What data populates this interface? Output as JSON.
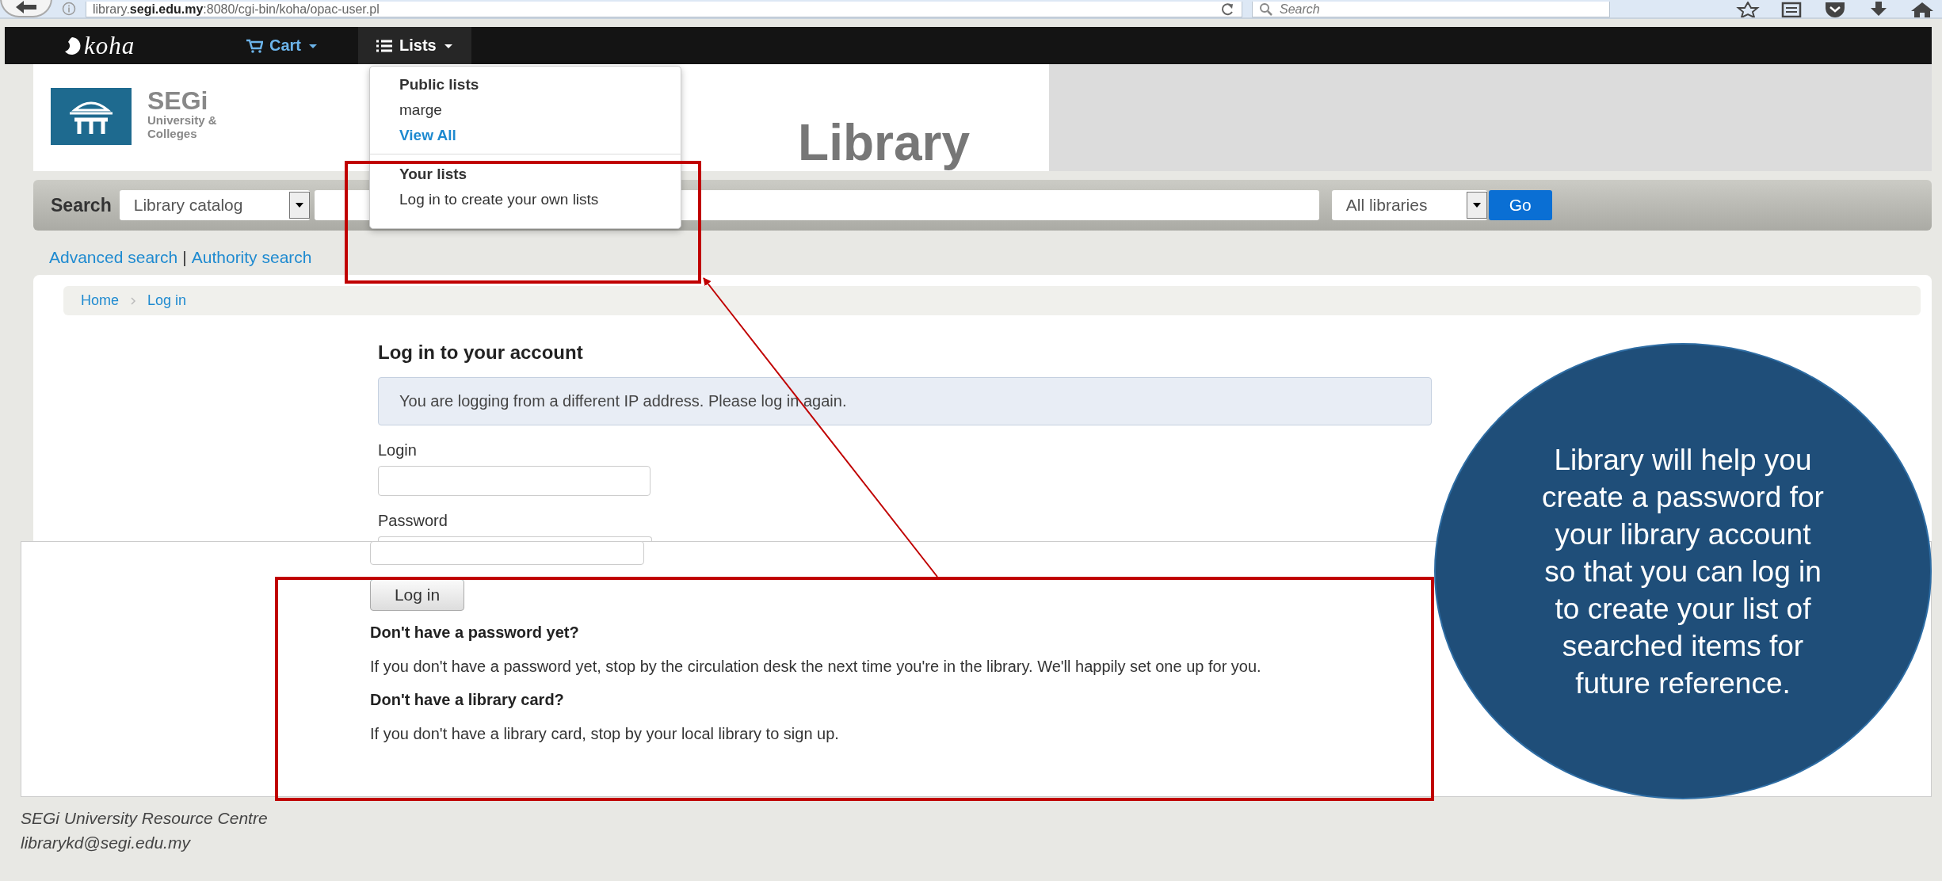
{
  "browser": {
    "address": "library.**segi.edu.my**:8080/cgi-bin/koha/opac-user.pl",
    "search_placeholder": "Search"
  },
  "navbar": {
    "logo": "koha",
    "menus": [
      {
        "label": "Cart",
        "kind": "cart",
        "expanded": false
      },
      {
        "label": "Lists",
        "kind": "lists",
        "expanded": true
      }
    ]
  },
  "lists_menu": {
    "sections": [
      {
        "heading": "Public lists",
        "items": [
          {
            "label": "marge",
            "kind": "plain"
          },
          {
            "label": "View All",
            "kind": "link"
          }
        ]
      },
      {
        "heading": "Your lists",
        "items": [
          {
            "label": "Log in to create your own lists",
            "kind": "plain"
          }
        ]
      }
    ]
  },
  "header": {
    "brand": "SEGi",
    "brand_sub": [
      "University &",
      "Colleges"
    ],
    "title": "Library"
  },
  "search": {
    "label": "Search",
    "scope": "Library catalog",
    "library": "All libraries",
    "button": "Go"
  },
  "links": [
    {
      "label": "Advanced search"
    },
    {
      "label": "Authority search"
    }
  ],
  "links_separator": "|",
  "breadcrumb": [
    "Home",
    "Log in"
  ],
  "login": {
    "heading": "Log in to your account",
    "alert": "You are logging from a different IP address. Please log in again.",
    "login_label": "Login",
    "password_label": "Password",
    "button": "Log in",
    "sections": [
      {
        "heading": "Don't have a password yet?",
        "text": "If you don't have a password yet, stop by the circulation desk the next time you're in the library. We'll happily set one up for you."
      },
      {
        "heading": "Don't have a library card?",
        "text": "If you don't have a library card, stop by your local library to sign up."
      }
    ]
  },
  "footer": [
    "SEGi University Resource Centre",
    "librarykd@segi.edu.my"
  ],
  "callout": {
    "text": "Library will help you create a password for your library account so that you can log in to create your list of searched items for future reference."
  }
}
